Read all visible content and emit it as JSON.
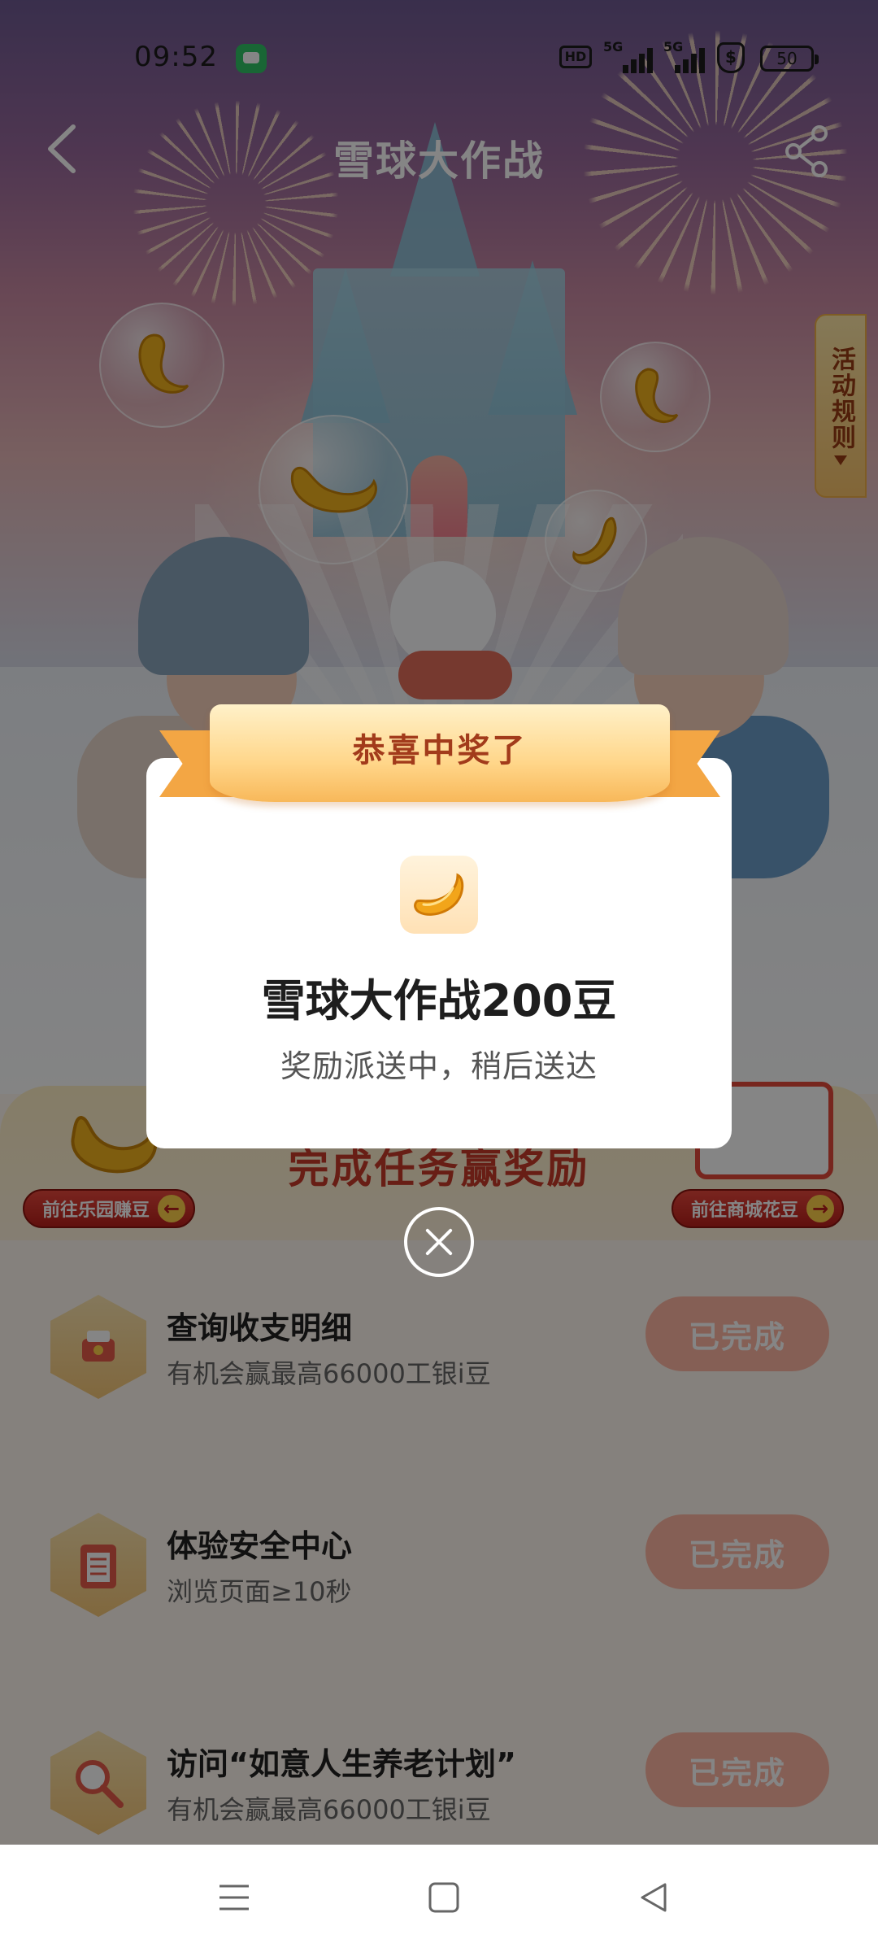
{
  "status_bar": {
    "time": "09:52",
    "hd_label": "HD",
    "signal1_label": "5G",
    "signal2_label": "5G",
    "shield_label": "$",
    "battery": "50"
  },
  "header": {
    "title": "雪球大作战"
  },
  "side_tab": {
    "label": "活动规则"
  },
  "task_section": {
    "banner_title": "完成任务赢奖励",
    "left_link": "前往乐园赚豆",
    "right_link": "前往商城花豆",
    "tasks": [
      {
        "title": "查询收支明细",
        "desc": "有机会赢最高66000工银i豆",
        "button": "已完成"
      },
      {
        "title": "体验安全中心",
        "desc": "浏览页面≥10秒",
        "button": "已完成"
      },
      {
        "title": "访问“如意人生养老计划”",
        "desc": "有机会赢最高66000工银i豆",
        "button": "已完成"
      }
    ]
  },
  "modal": {
    "ribbon": "恭喜中奖了",
    "prize_title": "雪球大作战200豆",
    "prize_sub": "奖励派送中，稍后送达"
  },
  "colors": {
    "accent_red": "#c73a2a",
    "button_done": "#ffb7a3",
    "ribbon_gold": "#ffd68a"
  }
}
